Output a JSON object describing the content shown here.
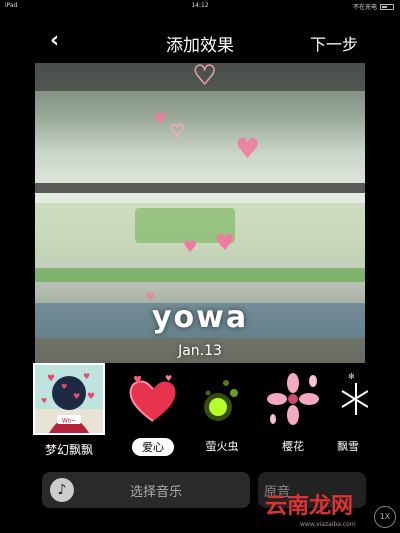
{
  "status_bar": {
    "left": "iPad",
    "time": "14:12",
    "right": "不在充电"
  },
  "navbar": {
    "title": "添加效果",
    "next_label": "下一步"
  },
  "preview": {
    "logo_text": "yowa",
    "date_text": "Jan.13"
  },
  "effects": [
    {
      "label": "梦幻飘飘",
      "icon": "avatar-hearts-icon",
      "selected": false
    },
    {
      "label": "爱心",
      "icon": "heart-icon",
      "selected": true
    },
    {
      "label": "萤火虫",
      "icon": "firefly-icon",
      "selected": false
    },
    {
      "label": "樱花",
      "icon": "sakura-icon",
      "selected": false
    },
    {
      "label": "飘雪",
      "icon": "snowflake-icon",
      "selected": false
    }
  ],
  "bottom": {
    "music_label": "选择音乐",
    "original_label": "原音",
    "speed_label": "1X"
  },
  "watermark": {
    "text": "云南龙网",
    "url": "www.xiazaiba.com"
  }
}
